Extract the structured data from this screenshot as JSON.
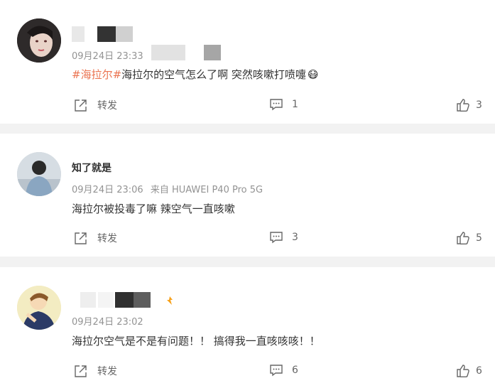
{
  "comments": [
    {
      "time": "09月24日 23:33",
      "text_tag": "#海拉尔#",
      "text": "海拉尔的空气怎么了啊 突然咳嗽打喷嚏",
      "emoji": "😷",
      "repost_label": "转发",
      "comment_count": "1",
      "like_count": "3"
    },
    {
      "name": "知了就是",
      "time": "09月24日 23:06",
      "source": "来自 HUAWEI P40 Pro 5G",
      "text": "海拉尔被投毒了嘛 辣空气一直咳嗽",
      "repost_label": "转发",
      "comment_count": "3",
      "like_count": "5"
    },
    {
      "time": "09月24日 23:02",
      "text": "海拉尔空气是不是有问题！！ 搞得我一直咳咳咳！！",
      "repost_label": "转发",
      "comment_count": "6",
      "like_count": "6"
    }
  ],
  "colors": {
    "tag": "#eb7350",
    "meta": "#939393",
    "background": "#f2f2f2"
  }
}
